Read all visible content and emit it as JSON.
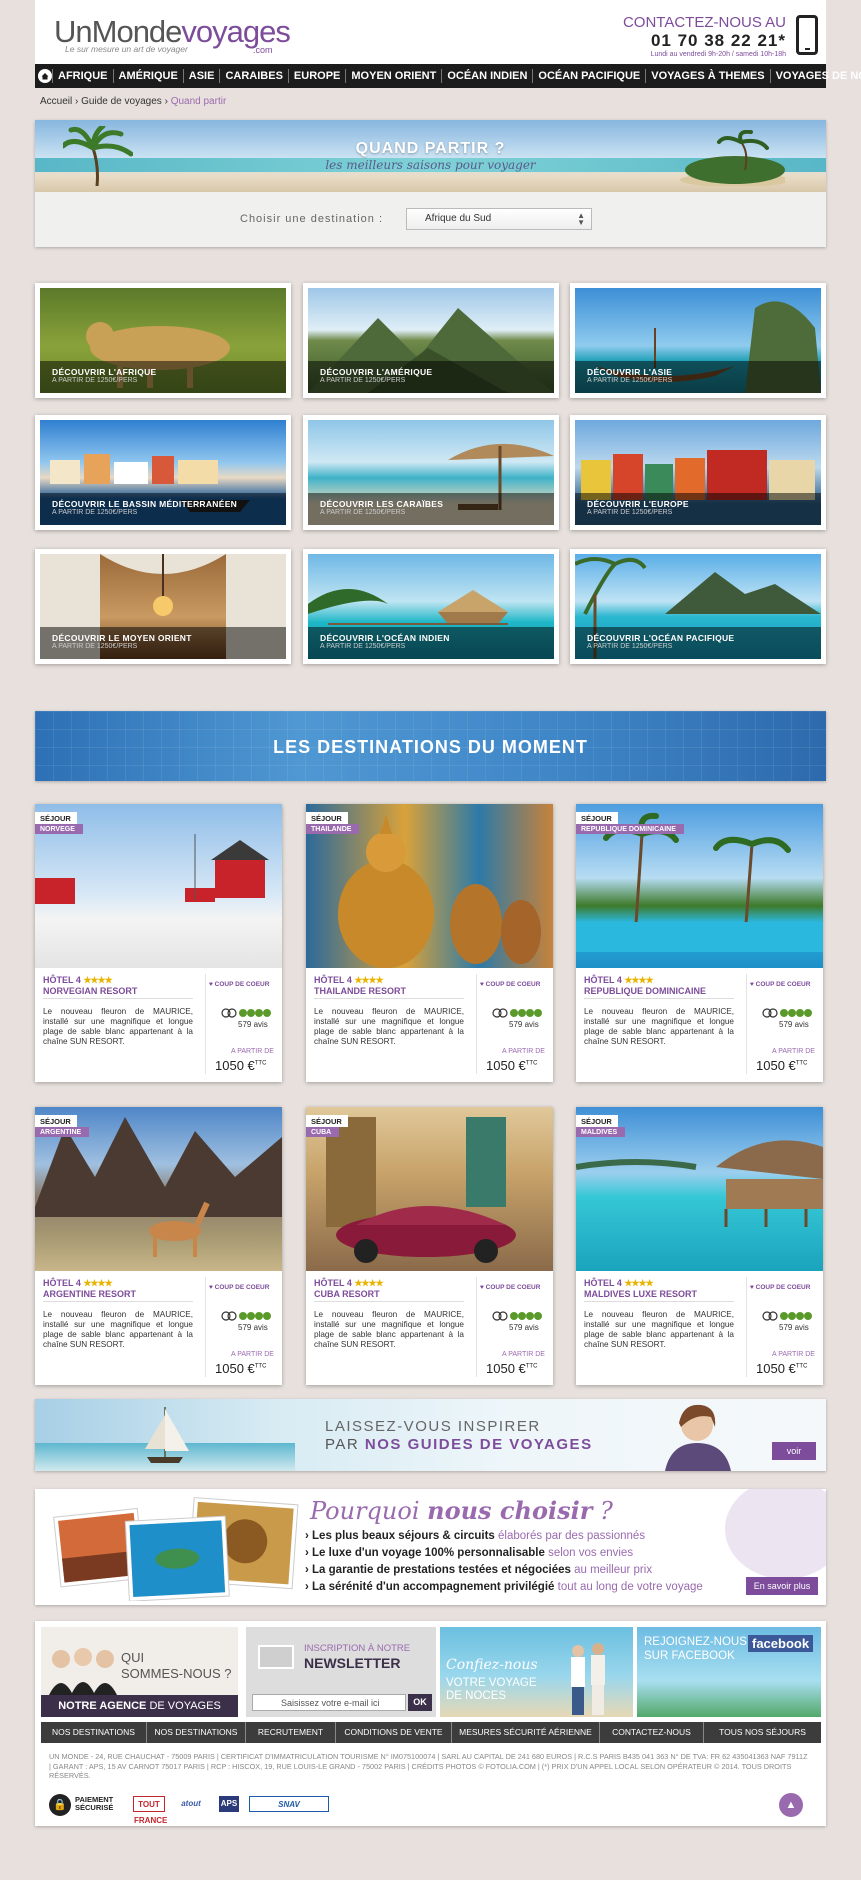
{
  "header": {
    "logo_part1": "UnMonde",
    "logo_part2": "voyages",
    "logo_com": ".com",
    "tagline": "Le sur mesure un art de voyager",
    "contact_label": "CONTACTEZ-NOUS AU",
    "phone": "01 70 38 22 21*",
    "hours": "Lundi au vendredi 9h-20h / samedi 10h-18h"
  },
  "nav": [
    "AFRIQUE",
    "AMÉRIQUE",
    "ASIE",
    "CARAIBES",
    "EUROPE",
    "MOYEN ORIENT",
    "OCÉAN INDIEN",
    "OCÉAN PACIFIQUE",
    "VOYAGES À THEMES",
    "VOYAGES DE NOCES"
  ],
  "breadcrumb": {
    "home": "Accueil",
    "guide": "Guide de voyages",
    "current": "Quand partir",
    "sep": "›"
  },
  "quand_partir": {
    "title": "QUAND PARTIR ?",
    "subtitle": "les meilleurs saisons pour voyager",
    "label": "Choisir une destination :",
    "selected": "Afrique du Sud"
  },
  "tiles": [
    {
      "title": "DÉCOUVRIR L'AFRIQUE",
      "price": "A PARTIR DE 1250€/PERS"
    },
    {
      "title": "DÉCOUVRIR L'AMÉRIQUE",
      "price": "A PARTIR DE 1250€/PERS"
    },
    {
      "title": "DÉCOUVRIR L'ASIE",
      "price": "A PARTIR DE 1250€/PERS"
    },
    {
      "title": "DÉCOUVRIR LE BASSIN MÉDITERRANÉEN",
      "price": "A PARTIR DE 1250€/PERS"
    },
    {
      "title": "DÉCOUVRIR LES CARAÏBES",
      "price": "A PARTIR DE 1250€/PERS"
    },
    {
      "title": "DÉCOUVRIR L'EUROPE",
      "price": "A PARTIR DE 1250€/PERS"
    },
    {
      "title": "DÉCOUVRIR LE MOYEN ORIENT",
      "price": "A PARTIR DE 1250€/PERS"
    },
    {
      "title": "DÉCOUVRIR L'OCÉAN INDIEN",
      "price": "A PARTIR DE 1250€/PERS"
    },
    {
      "title": "DÉCOUVRIR L'OCÉAN PACIFIQUE",
      "price": "A PARTIR DE 1250€/PERS"
    }
  ],
  "moment": {
    "title": "LES DESTINATIONS DU MOMENT"
  },
  "cards": [
    {
      "type": "SÉJOUR",
      "country": "NORVEGE",
      "hotel": "HÔTEL 4",
      "stars": "★★★★",
      "name": "NORVEGIAN RESORT",
      "badge": "♥ COUP DE COEUR",
      "desc": "Le nouveau fleuron de MAURICE, installé sur une magnifique et longue plage de sable blanc appartenant à la chaîne SUN RESORT.",
      "reviews": "579 avis",
      "from": "A PARTIR DE",
      "price": "1050 €",
      "ttc": "TTC"
    },
    {
      "type": "SÉJOUR",
      "country": "THAILANDE",
      "hotel": "HÔTEL 4",
      "stars": "★★★★",
      "name": "THAILANDE RESORT",
      "badge": "♥ COUP DE COEUR",
      "desc": "Le nouveau fleuron de MAURICE, installé sur une magnifique et longue plage de sable blanc appartenant à la chaîne SUN RESORT.",
      "reviews": "579 avis",
      "from": "A PARTIR DE",
      "price": "1050 €",
      "ttc": "TTC"
    },
    {
      "type": "SÉJOUR",
      "country": "REPUBLIQUE DOMINICAINE",
      "hotel": "HÔTEL 4",
      "stars": "★★★★",
      "name": "REPUBLIQUE DOMINICAINE",
      "badge": "♥ COUP DE COEUR",
      "desc": "Le nouveau fleuron de MAURICE, installé sur une magnifique et longue plage de sable blanc appartenant à la chaîne SUN RESORT.",
      "reviews": "579 avis",
      "from": "A PARTIR DE",
      "price": "1050 €",
      "ttc": "TTC"
    },
    {
      "type": "SÉJOUR",
      "country": "ARGENTINE",
      "hotel": "HÔTEL 4",
      "stars": "★★★★",
      "name": "ARGENTINE RESORT",
      "badge": "♥ COUP DE COEUR",
      "desc": "Le nouveau fleuron de MAURICE, installé sur une magnifique et longue plage de sable blanc appartenant à la chaîne SUN RESORT.",
      "reviews": "579 avis",
      "from": "A PARTIR DE",
      "price": "1050 €",
      "ttc": "TTC"
    },
    {
      "type": "SÉJOUR",
      "country": "CUBA",
      "hotel": "HÔTEL 4",
      "stars": "★★★★",
      "name": "CUBA RESORT",
      "badge": "♥ COUP DE COEUR",
      "desc": "Le nouveau fleuron de MAURICE, installé sur une magnifique et longue plage de sable blanc appartenant à la chaîne SUN RESORT.",
      "reviews": "579 avis",
      "from": "A PARTIR DE",
      "price": "1050 €",
      "ttc": "TTC"
    },
    {
      "type": "SÉJOUR",
      "country": "MALDIVES",
      "hotel": "HÔTEL 4",
      "stars": "★★★★",
      "name": "MALDIVES LUXE RESORT",
      "badge": "♥ COUP DE COEUR",
      "desc": "Le nouveau fleuron de MAURICE, installé sur une magnifique et longue plage de sable blanc appartenant à la chaîne SUN RESORT.",
      "reviews": "579 avis",
      "from": "A PARTIR DE",
      "price": "1050 €",
      "ttc": "TTC"
    }
  ],
  "guides": {
    "line1": "LAISSEZ-VOUS INSPIRER",
    "line2_pre": "PAR",
    "line2_bold": "NOS GUIDES DE VOYAGES",
    "button": "voir"
  },
  "why": {
    "title_1": "Pourquoi",
    "title_2": "nous choisir",
    "title_3": "?",
    "items": [
      {
        "bold": "Les plus beaux séjours & circuits",
        "light": "élaborés par des passionnés"
      },
      {
        "bold": "Le luxe d'un voyage 100% personnalisable",
        "light": "selon vos envies"
      },
      {
        "bold": "La garantie de prestations testées et négociées",
        "light": "au meilleur prix"
      },
      {
        "bold": "La sérénité d'un accompagnement privilégié",
        "light": "tout au long de votre voyage"
      }
    ],
    "button": "En savoir plus"
  },
  "footer": {
    "qui1": "QUI",
    "qui2": "SOMMES-NOUS ?",
    "agence_bold": "NOTRE AGENCE",
    "agence_rest": "DE VOYAGES",
    "nl1": "INSCRIPTION À NOTRE",
    "nl2": "NEWSLETTER",
    "nl_placeholder": "Saisissez votre e-mail ici",
    "nl_ok": "OK",
    "noces_script": "Confiez-nous",
    "noces_l1": "VOTRE VOYAGE",
    "noces_l2": "DE NOCES",
    "fb_l1": "REJOIGNEZ-NOUS",
    "fb_l2": "SUR FACEBOOK",
    "fb_logo": "facebook",
    "links": [
      "NOS DESTINATIONS",
      "NOS DESTINATIONS",
      "RECRUTEMENT",
      "CONDITIONS DE VENTE",
      "MESURES SÉCURITÉ AÉRIENNE",
      "CONTACTEZ-NOUS",
      "TOUS NOS SÉJOURS"
    ],
    "legal": "UN MONDE - 24, RUE CHAUCHAT - 75009 PARIS | CERTIFICAT D'IMMATRICULATION TOURISME N° IM075100074 | SARL AU CAPITAL DE 241 680 EUROS | R.C.S PARIS B435 041 363 N° DE TVA: FR 62 435041363 NAF 7911Z | GARANT : APS, 15 AV CARNOT 75017 PARIS | RCP : HISCOX, 19, RUE LOUIS-LE GRAND - 75002 PARIS | CRÉDITS PHOTOS © FOTOLIA.COM | (*) PRIX D'UN APPEL LOCAL SELON OPÉRATEUR © 2014. TOUS DROITS RÉSERVÉS.",
    "secure1": "PAIEMENT",
    "secure2": "SÉCURISÉ",
    "partners": [
      "TOUT FRANCE",
      "atout",
      "APS",
      "SNAV"
    ]
  }
}
